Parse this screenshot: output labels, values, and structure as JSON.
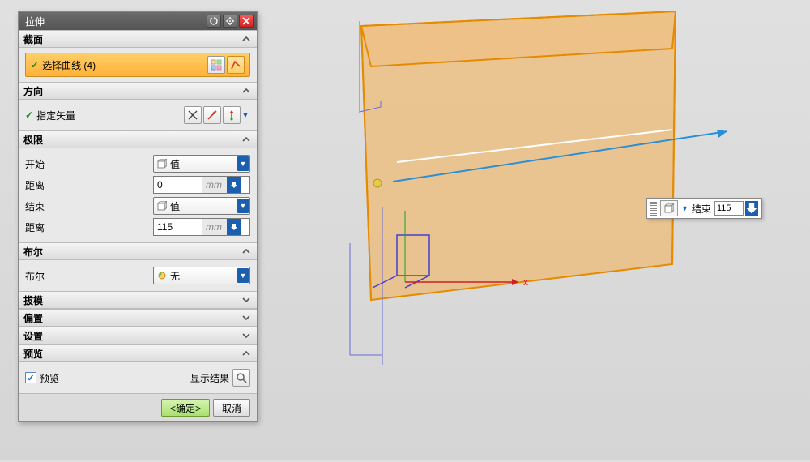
{
  "dialog": {
    "title": "拉伸",
    "sections": {
      "section_profile": {
        "label": "截面",
        "select_curve": "选择曲线 (4)"
      },
      "direction": {
        "label": "方向",
        "specify_vector": "指定矢量"
      },
      "limits": {
        "label": "极限",
        "start_label": "开始",
        "start_type": "值",
        "start_dist_label": "距离",
        "start_dist_value": "0",
        "start_dist_unit": "mm",
        "end_label": "结束",
        "end_type": "值",
        "end_dist_label": "距离",
        "end_dist_value": "115",
        "end_dist_unit": "mm"
      },
      "boolean": {
        "label": "布尔",
        "field_label": "布尔",
        "value": "无"
      },
      "draft": {
        "label": "拔模"
      },
      "offset": {
        "label": "偏置"
      },
      "settings": {
        "label": "设置"
      },
      "preview": {
        "label": "预览",
        "checkbox_label": "预览",
        "show_result": "显示结果"
      }
    },
    "footer": {
      "ok": "<确定>",
      "cancel": "取消"
    }
  },
  "floating": {
    "label": "结束",
    "value": "115"
  },
  "axes": {
    "x": "x"
  }
}
